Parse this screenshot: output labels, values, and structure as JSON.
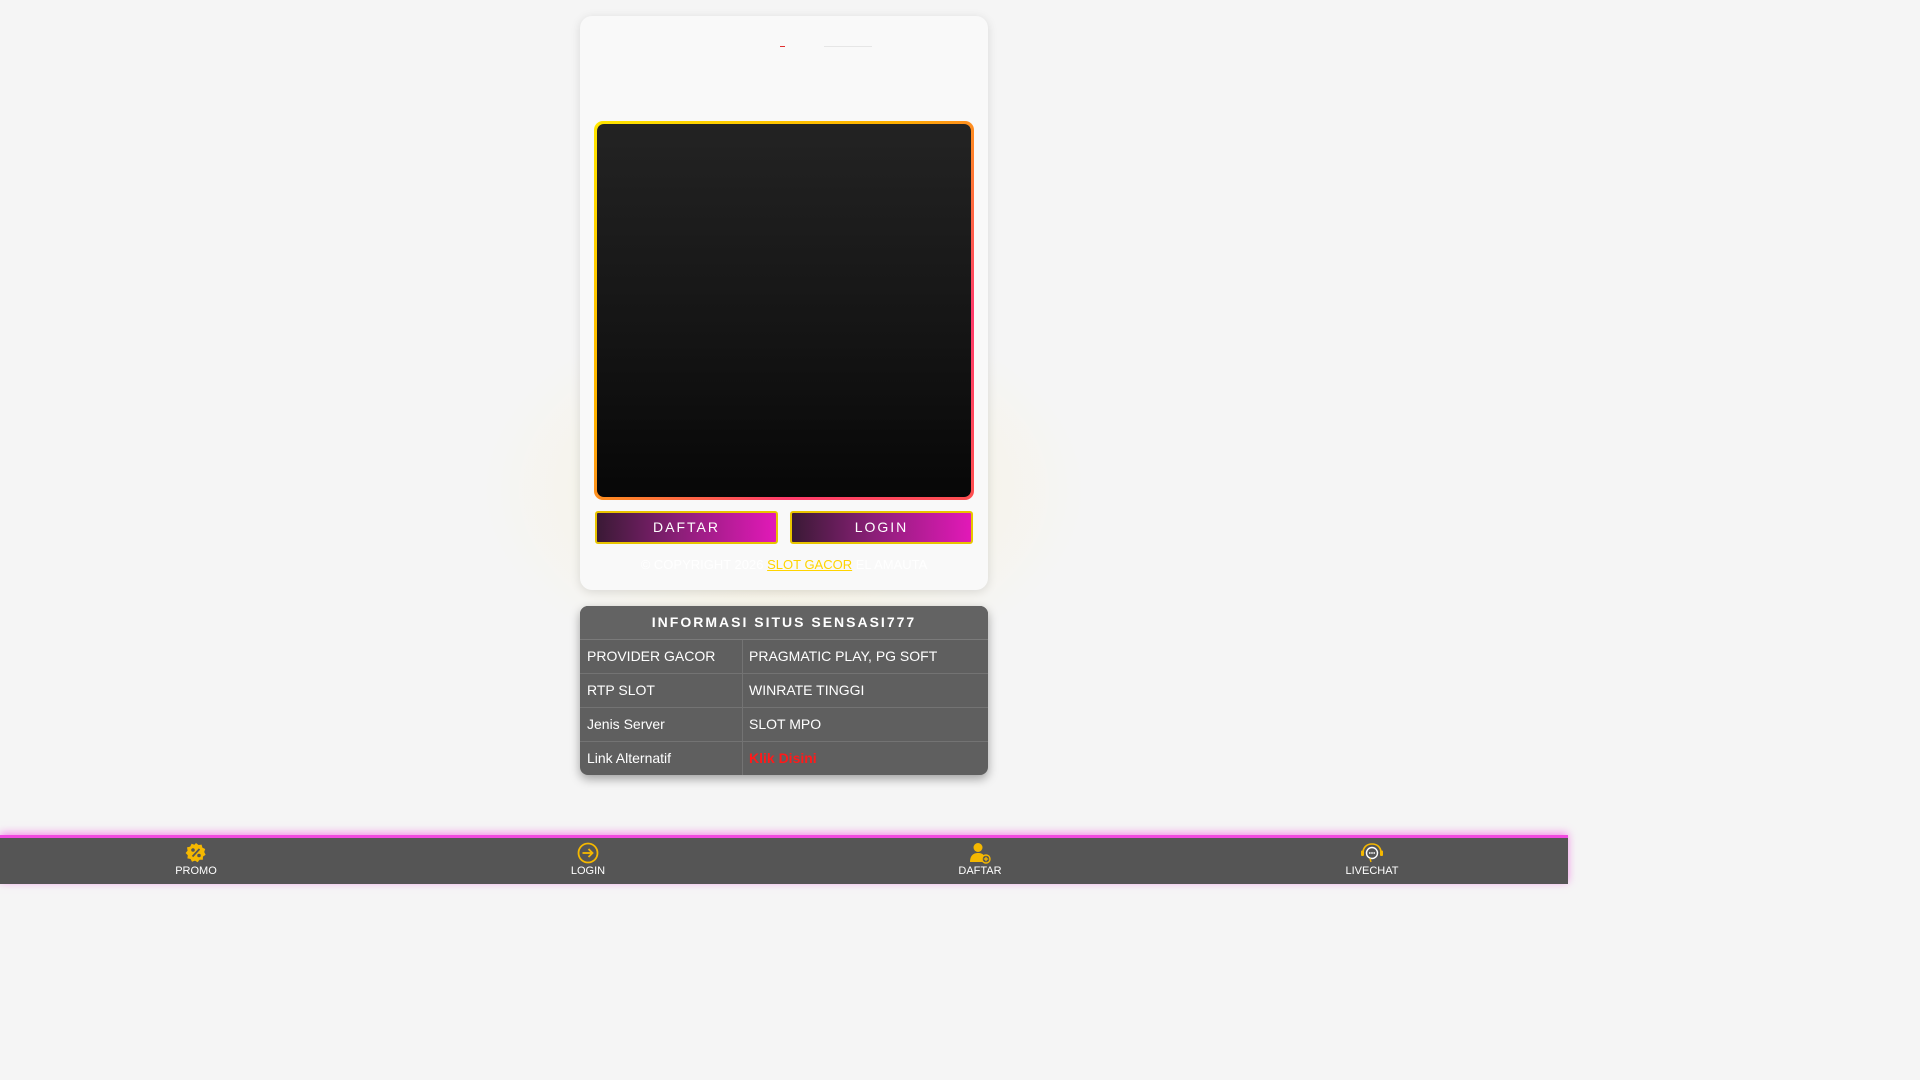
{
  "buttons": {
    "daftar_label": "DAFTAR",
    "login_label": "LOGIN"
  },
  "footer": {
    "copyright_prefix": "© COPYRIGHT 2026",
    "copyright_link": "SLOT GACOR",
    "copyright_suffix": "EL AMAUTA"
  },
  "info_table": {
    "title": "INFORMASI SITUS SENSASI777",
    "rows": [
      {
        "key": "PROVIDER GACOR",
        "value": "PRAGMATIC PLAY, PG SOFT"
      },
      {
        "key": "RTP SLOT",
        "value": "WINRATE TINGGI"
      },
      {
        "key": "Jenis Server",
        "value": "SLOT MPO"
      },
      {
        "key": "Link Alternatif",
        "value": "Klik Disini"
      }
    ]
  },
  "bottom_nav": {
    "items": [
      {
        "label": "PROMO",
        "icon": "promo-icon"
      },
      {
        "label": "LOGIN",
        "icon": "login-icon"
      },
      {
        "label": "DAFTAR",
        "icon": "daftar-icon"
      },
      {
        "label": "LIVECHAT",
        "icon": "livechat-icon"
      }
    ]
  },
  "colors": {
    "accent_gold": "#ffd400",
    "accent_magenta": "#e219b8",
    "link_red": "#ff1a1a",
    "bar_gray": "#555555"
  }
}
